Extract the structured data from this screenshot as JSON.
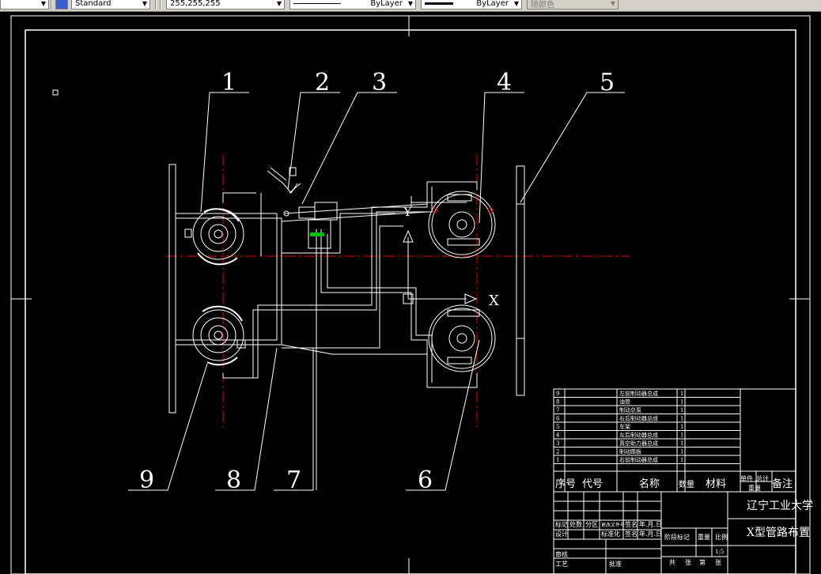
{
  "toolbar": {
    "text_style": "Standard",
    "color": "255,255,255",
    "linetype": "ByLayer",
    "lineweight": "ByLayer",
    "plot_style": "随颜色"
  },
  "drawing": {
    "labels": [
      "1",
      "2",
      "3",
      "4",
      "5",
      "6",
      "7",
      "8",
      "9"
    ],
    "axis_y": "Y",
    "axis_x": "X",
    "bom": {
      "rows": [
        {
          "no": "9",
          "name": "左前制动器总成",
          "qty": "1"
        },
        {
          "no": "8",
          "name": "油管",
          "qty": "1"
        },
        {
          "no": "7",
          "name": "制动总泵",
          "qty": "1"
        },
        {
          "no": "6",
          "name": "右后制动器总成",
          "qty": "1"
        },
        {
          "no": "5",
          "name": "车架",
          "qty": "1"
        },
        {
          "no": "4",
          "name": "左后制动器总成",
          "qty": "1"
        },
        {
          "no": "3",
          "name": "真空助力器总成",
          "qty": "1"
        },
        {
          "no": "2",
          "name": "制动踏板",
          "qty": "1"
        },
        {
          "no": "1",
          "name": "右前制动器总成",
          "qty": "1"
        }
      ],
      "header": {
        "no": "序号",
        "code": "代号",
        "name": "名称",
        "qty": "数量",
        "material": "材料",
        "single": "单件",
        "total": "总计",
        "weight": "重量",
        "remark": "备注"
      }
    },
    "title_block": {
      "school": "辽宁工业大学",
      "title": "X型管路布置",
      "scale": "1:5",
      "r1": [
        "标记",
        "处数",
        "分区",
        "更改文件号",
        "签名",
        "年.月.日"
      ],
      "r2": [
        "设计",
        "",
        "标准化",
        "签名",
        "年.月.日"
      ],
      "stage": [
        "阶段标记",
        "重量",
        "比例"
      ],
      "bottom": [
        "审核",
        "",
        "批准",
        "共",
        "张",
        "第",
        "张"
      ],
      "craft": "工艺"
    }
  }
}
